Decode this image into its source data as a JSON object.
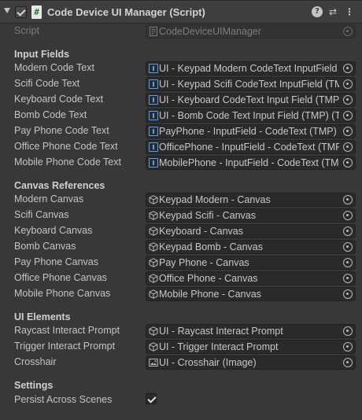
{
  "header": {
    "title": "Code Device UI Manager (Script)",
    "script_icon_glyph": "#",
    "help_glyph": "?",
    "preset_glyph": "⇄",
    "menu_glyph": "⋮"
  },
  "script": {
    "label": "Script",
    "value": "CodeDeviceUIManager"
  },
  "sections": {
    "input_fields": "Input Fields",
    "canvas_references": "Canvas References",
    "ui_elements": "UI Elements",
    "settings": "Settings"
  },
  "input_fields": [
    {
      "label": "Modern Code Text",
      "value": "UI - Keypad Modern CodeText InputField (TMP)"
    },
    {
      "label": "Scifi Code Text",
      "value": "UI - Keypad Scifi CodeText InputField (TMP)"
    },
    {
      "label": "Keyboard Code Text",
      "value": "UI - Keyboard CodeText Input Field (TMP)"
    },
    {
      "label": "Bomb Code Text",
      "value": "UI - Bomb Code Text Input Field (TMP) (TMP)"
    },
    {
      "label": "Pay Phone Code Text",
      "value": "PayPhone - InputField - CodeText (TMP)"
    },
    {
      "label": "Office Phone Code Text",
      "value": "OfficePhone - InputField - CodeText (TMP)"
    },
    {
      "label": "Mobile Phone Code Text",
      "value": "MobilePhone - InputField - CodeText (TMP)"
    }
  ],
  "canvas_references": [
    {
      "label": "Modern Canvas",
      "value": "Keypad Modern - Canvas"
    },
    {
      "label": "Scifi Canvas",
      "value": "Keypad Scifi - Canvas"
    },
    {
      "label": "Keyboard Canvas",
      "value": "Keyboard - Canvas"
    },
    {
      "label": "Bomb Canvas",
      "value": "Keypad Bomb - Canvas"
    },
    {
      "label": "Pay Phone Canvas",
      "value": "Pay Phone - Canvas"
    },
    {
      "label": "Office Phone Canvas",
      "value": "Office Phone - Canvas"
    },
    {
      "label": "Mobile Phone Canvas",
      "value": "Mobile Phone - Canvas"
    }
  ],
  "ui_elements": [
    {
      "label": "Raycast Interact Prompt",
      "value": "UI - Raycast Interact Prompt",
      "icon": "canvas-icon"
    },
    {
      "label": "Trigger Interact Prompt",
      "value": "UI - Trigger Interact Prompt",
      "icon": "canvas-icon"
    },
    {
      "label": "Crosshair",
      "value": "UI - Crosshair (Image)",
      "icon": "image-icon"
    }
  ],
  "settings": {
    "persist_label": "Persist Across Scenes",
    "persist_checked": true
  }
}
